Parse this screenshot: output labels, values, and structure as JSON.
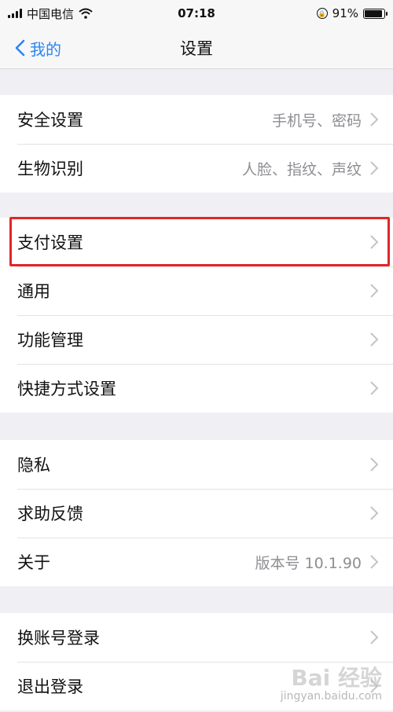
{
  "status_bar": {
    "carrier": "中国电信",
    "time": "07:18",
    "battery": "91%",
    "battery_level": 0.91
  },
  "nav": {
    "back_label": "我的",
    "title": "设置"
  },
  "groups": [
    {
      "rows": [
        {
          "label": "安全设置",
          "detail": "手机号、密码"
        },
        {
          "label": "生物识别",
          "detail": "人脸、指纹、声纹"
        }
      ]
    },
    {
      "rows": [
        {
          "label": "支付设置",
          "detail": ""
        },
        {
          "label": "通用",
          "detail": ""
        },
        {
          "label": "功能管理",
          "detail": ""
        },
        {
          "label": "快捷方式设置",
          "detail": ""
        }
      ]
    },
    {
      "rows": [
        {
          "label": "隐私",
          "detail": ""
        },
        {
          "label": "求助反馈",
          "detail": ""
        },
        {
          "label": "关于",
          "detail": "版本号 10.1.90"
        }
      ]
    },
    {
      "rows": [
        {
          "label": "换账号登录",
          "detail": ""
        },
        {
          "label": "退出登录",
          "detail": ""
        }
      ]
    }
  ],
  "colors": {
    "accent": "#2a86f6",
    "highlight": "#e02626",
    "background": "#efeff4"
  },
  "watermark": {
    "text": "Bai 经验",
    "sub": "jingyan.baidu.com"
  }
}
